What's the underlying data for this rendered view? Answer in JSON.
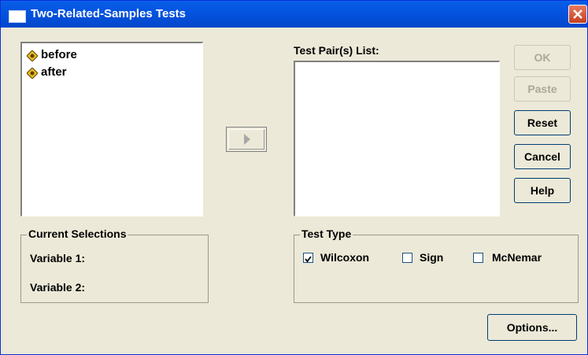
{
  "window": {
    "title": "Two-Related-Samples Tests"
  },
  "variables": [
    {
      "label": "before",
      "icon": "scale-variable-icon"
    },
    {
      "label": "after",
      "icon": "scale-variable-icon"
    }
  ],
  "test_pairs": {
    "label": "Test Pair(s) List:"
  },
  "buttons": {
    "ok": "OK",
    "paste": "Paste",
    "reset": "Reset",
    "cancel": "Cancel",
    "help": "Help",
    "options": "Options..."
  },
  "current_selections": {
    "title": "Current Selections",
    "variable1": "Variable 1:",
    "variable2": "Variable 2:"
  },
  "test_type": {
    "title": "Test Type",
    "wilcoxon": {
      "label": "Wilcoxon",
      "checked": true
    },
    "sign": {
      "label": "Sign",
      "checked": false
    },
    "mcnemar": {
      "label": "McNemar",
      "checked": false
    }
  },
  "colors": {
    "titlebar": "#0454e0",
    "dialog_bg": "#ece9d8",
    "close": "#c5401f"
  }
}
